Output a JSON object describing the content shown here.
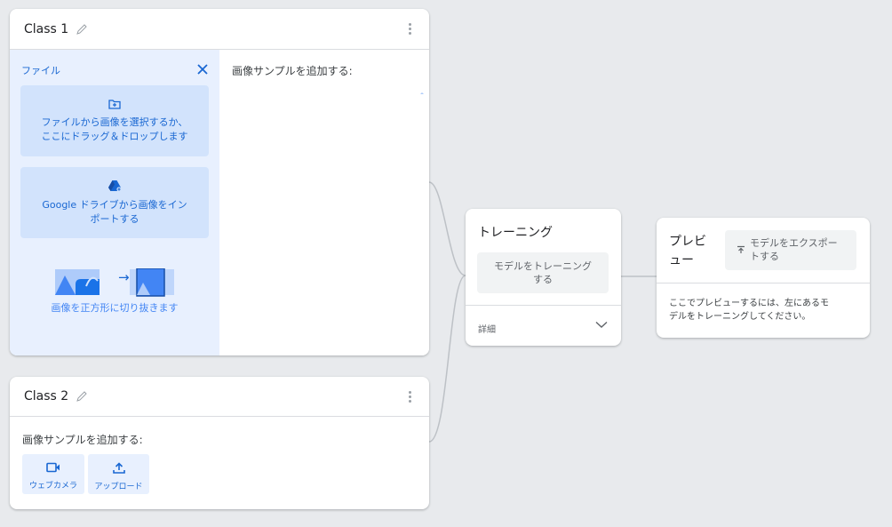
{
  "classes": [
    {
      "name": "Class 1"
    },
    {
      "name": "Class 2"
    }
  ],
  "upload_panel": {
    "title": "ファイル",
    "file_source_line1": "ファイルから画像を選択するか、",
    "file_source_line2": "ここにドラッグ＆ドロップします",
    "drive_source_line1": "Google ドライブから画像をイン",
    "drive_source_line2": "ポートする",
    "crop_text": "画像を正方形に切り抜きます",
    "arrow": "→"
  },
  "samples": {
    "add_label": "画像サンプルを追加する:"
  },
  "class2_sources": {
    "add_label": "画像サンプルを追加する:",
    "webcam_label": "ウェブカメラ",
    "upload_label": "アップロード"
  },
  "training": {
    "title": "トレーニング",
    "train_line1": "モデルをトレーニング",
    "train_line2": "する",
    "details_label": "詳細"
  },
  "preview": {
    "title_line1": "プレビ",
    "title_line2": "ュー",
    "export_line1": "モデルをエクスポー",
    "export_line2": "トする",
    "hint_line1": "ここでプレビューするには、左にあるモ",
    "hint_line2": "デルをトレーニングしてください。"
  },
  "colors": {
    "background": "#e8eaed",
    "accent": "#1967d2",
    "panel_bg": "#e8f0fe",
    "source_box_bg": "#d2e3fc",
    "button_bg": "#f1f3f4"
  }
}
